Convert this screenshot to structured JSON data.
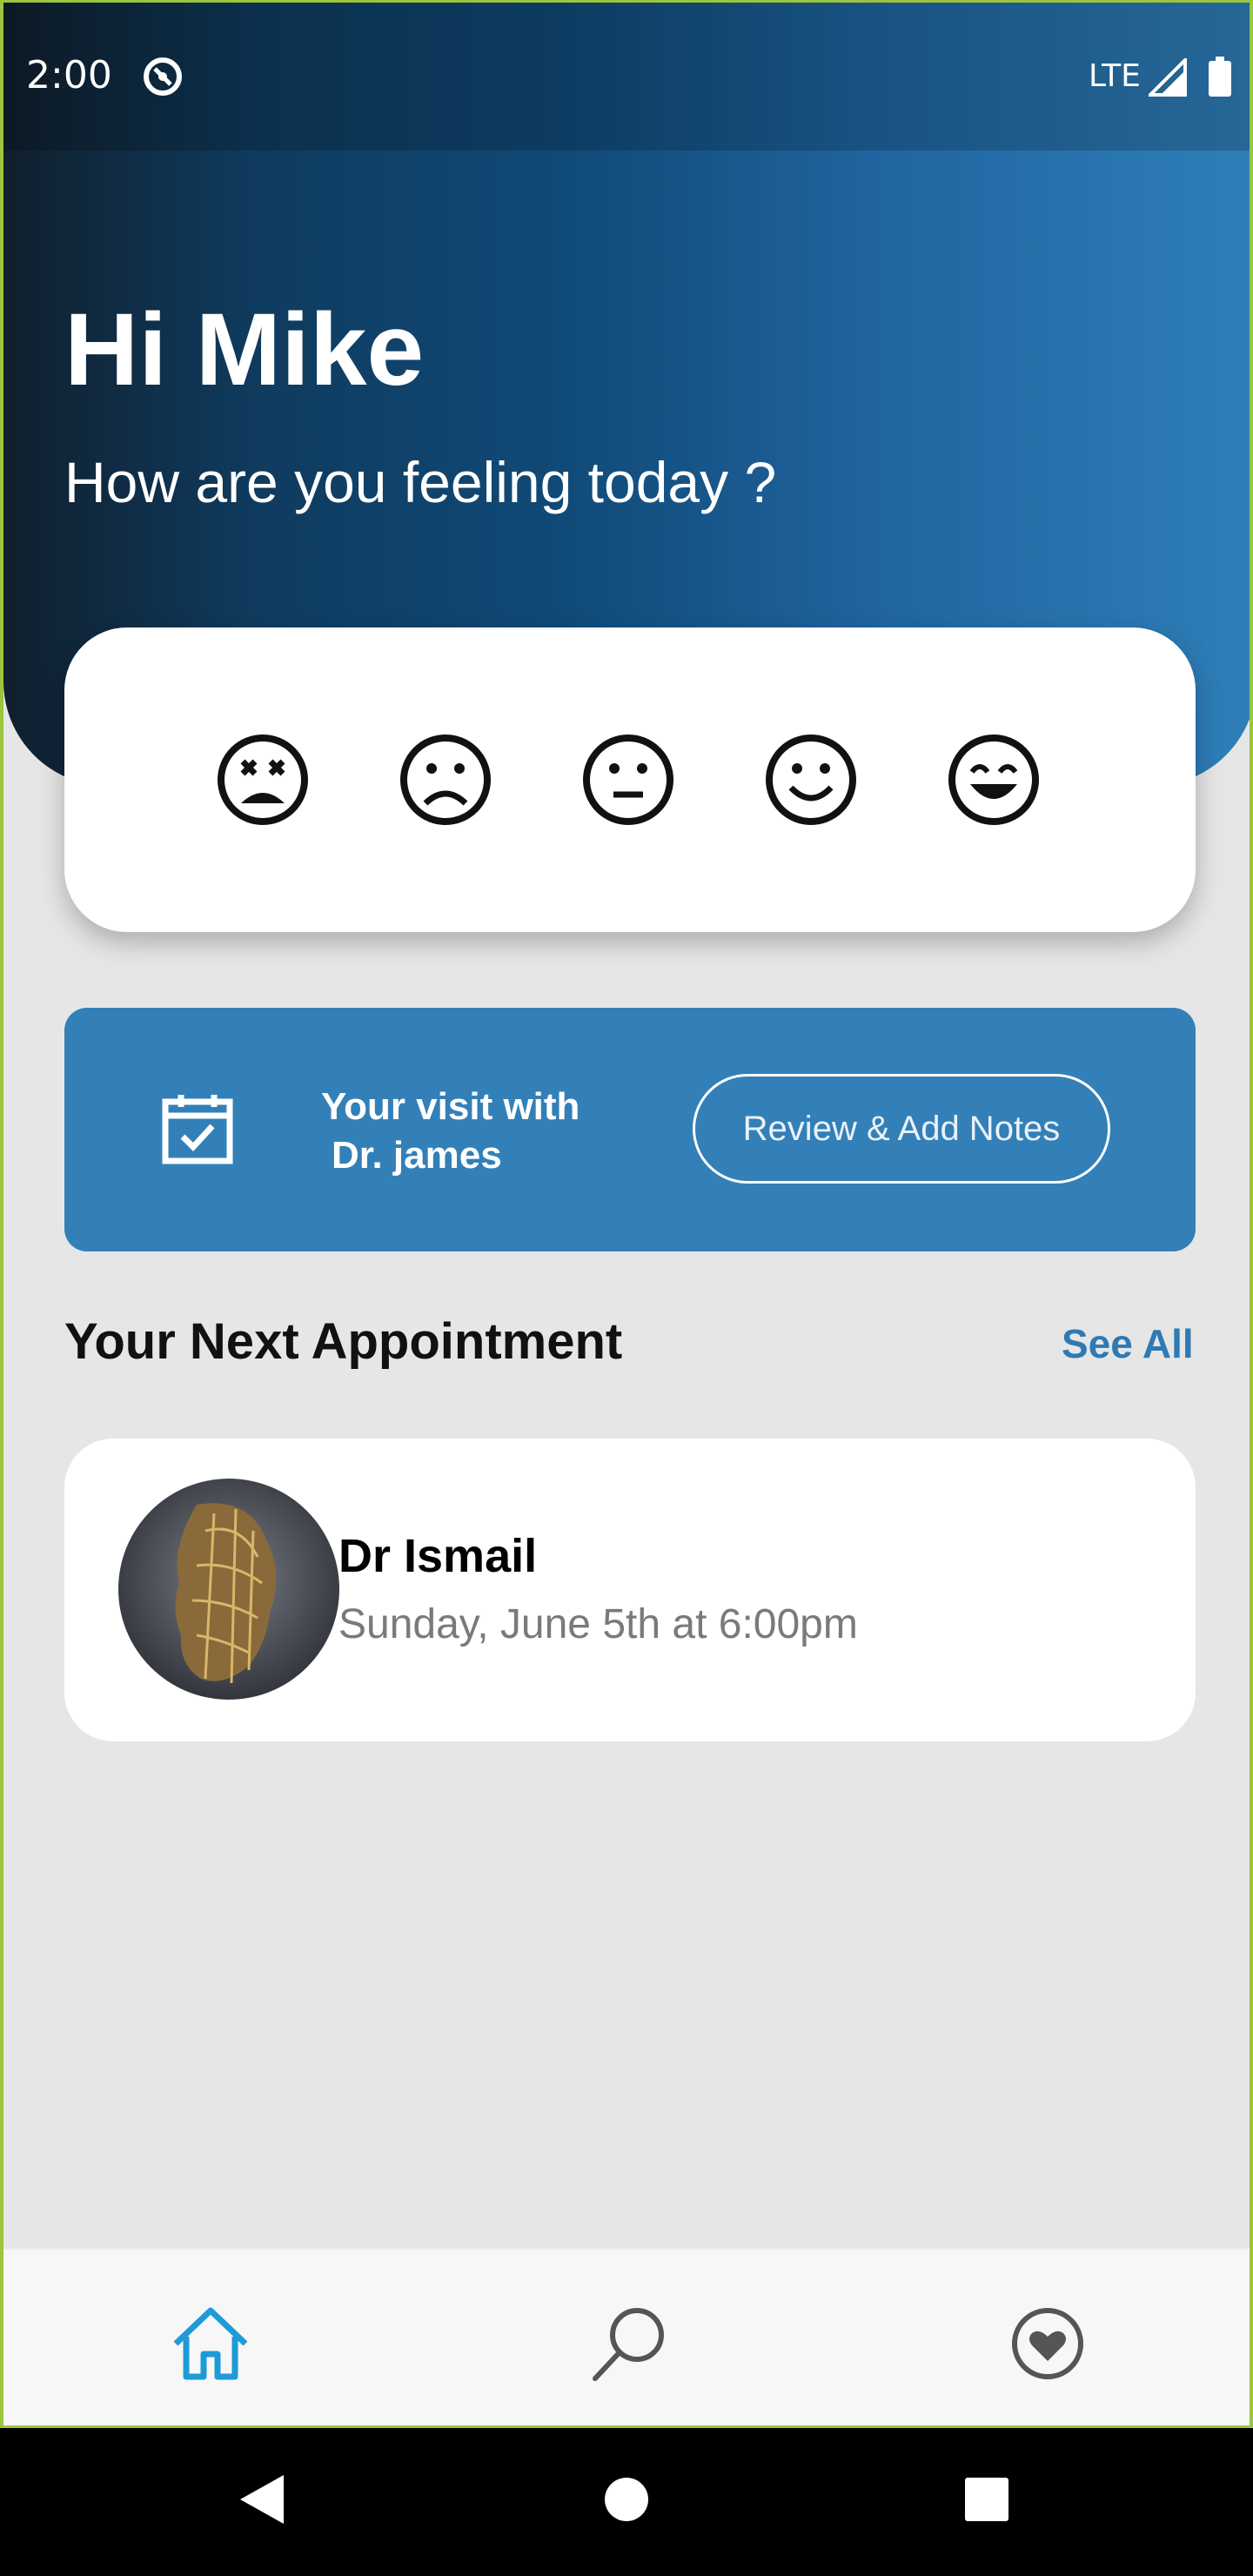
{
  "status_bar": {
    "time": "2:00",
    "network": "LTE"
  },
  "header": {
    "greeting": "Hi Mike",
    "subtitle": "How are you feeling today ?"
  },
  "mood_options": [
    "very-sad-face-icon",
    "sad-face-icon",
    "neutral-face-icon",
    "happy-face-icon",
    "very-happy-face-icon"
  ],
  "visit_banner": {
    "line1": "Your visit with",
    "line2": "Dr. james",
    "button_label": "Review & Add Notes"
  },
  "next_appointment": {
    "section_title": "Your Next Appointment",
    "see_all_label": "See All",
    "doctor_name": "Dr Ismail",
    "date_time": "Sunday, June 5th at 6:00pm"
  },
  "bottom_nav": {
    "items": [
      "home-icon",
      "search-icon",
      "favorites-heart-icon"
    ],
    "active": "home-icon"
  },
  "colors": {
    "primary_blue": "#3380b8",
    "link_blue": "#2f7ab4",
    "active_nav": "#1e9bd7",
    "background": "#e6e6e6"
  }
}
